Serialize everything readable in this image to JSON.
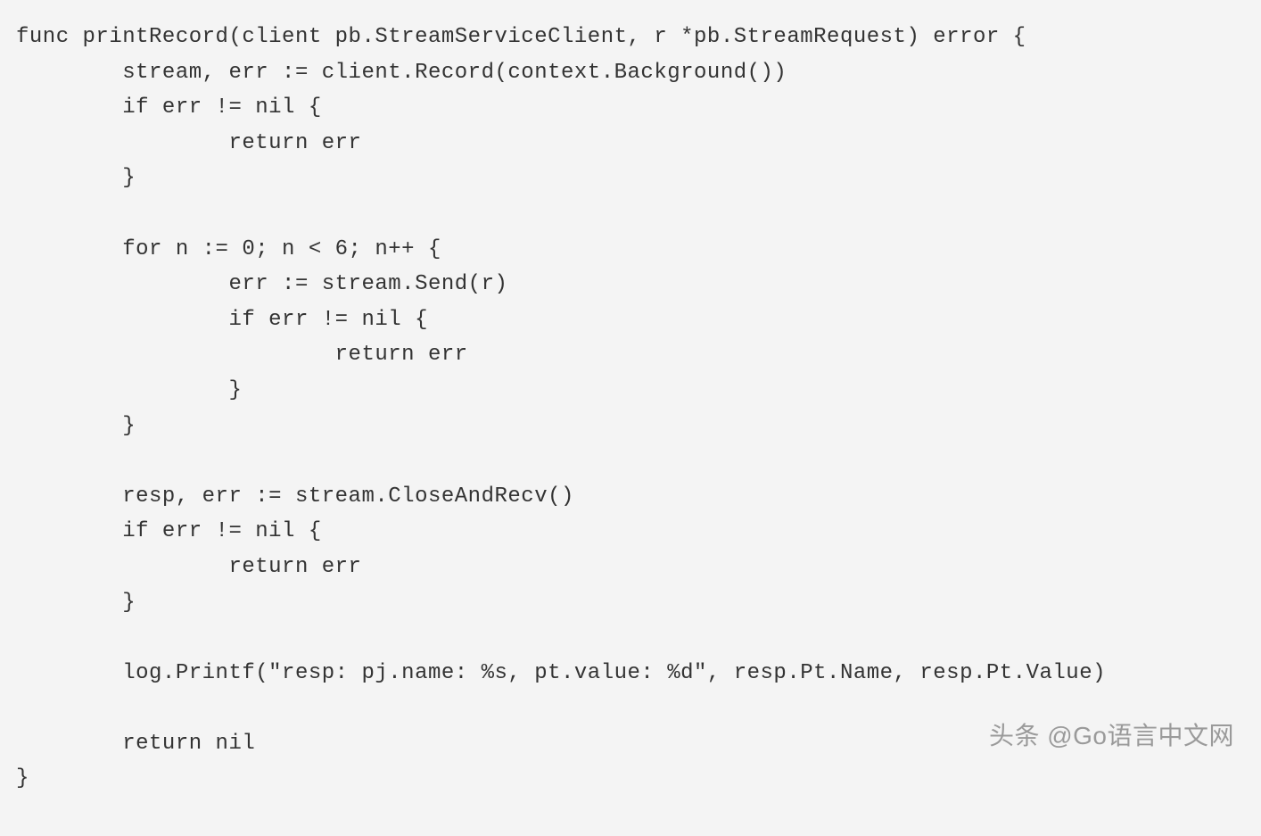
{
  "code": {
    "lines": [
      "func printRecord(client pb.StreamServiceClient, r *pb.StreamRequest) error {",
      "        stream, err := client.Record(context.Background())",
      "        if err != nil {",
      "                return err",
      "        }",
      "",
      "        for n := 0; n < 6; n++ {",
      "                err := stream.Send(r)",
      "                if err != nil {",
      "                        return err",
      "                }",
      "        }",
      "",
      "        resp, err := stream.CloseAndRecv()",
      "        if err != nil {",
      "                return err",
      "        }",
      "",
      "        log.Printf(\"resp: pj.name: %s, pt.value: %d\", resp.Pt.Name, resp.Pt.Value)",
      "",
      "        return nil",
      "}"
    ]
  },
  "watermark": {
    "text": "头条 @Go语言中文网"
  }
}
